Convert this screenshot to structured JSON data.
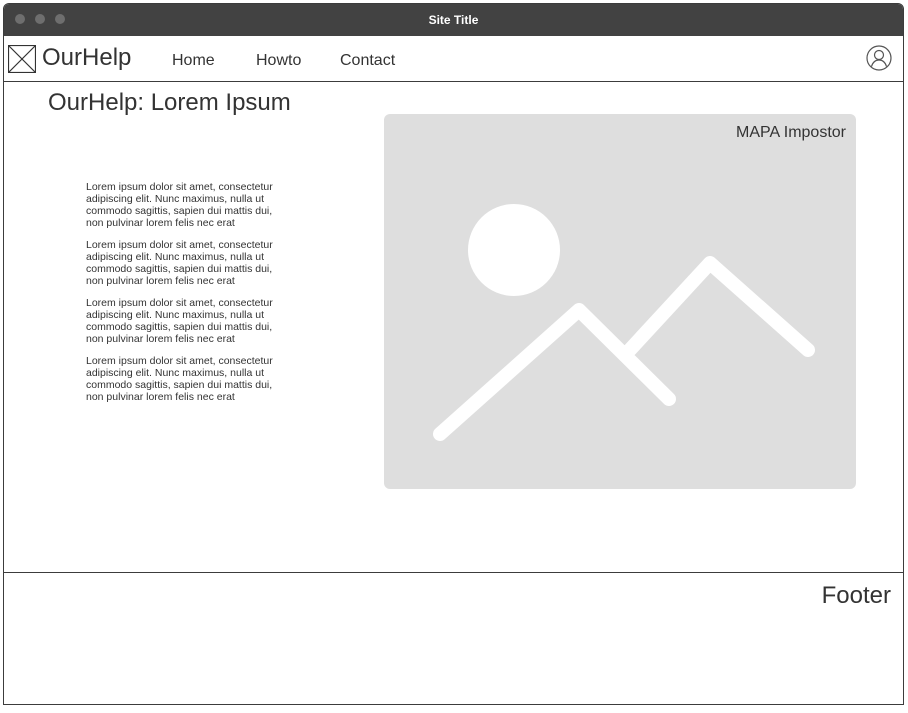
{
  "window": {
    "title": "Site Title"
  },
  "nav": {
    "brand": "OurHelp",
    "links": [
      "Home",
      "Howto",
      "Contact"
    ]
  },
  "main": {
    "headline": "OurHelp: Lorem Ipsum",
    "paragraphs": [
      "Lorem ipsum dolor sit amet, consectetur adipiscing elit. Nunc maximus, nulla ut commodo sagittis, sapien dui mattis dui, non pulvinar lorem felis nec erat",
      "Lorem ipsum dolor sit amet, consectetur adipiscing elit. Nunc maximus, nulla ut commodo sagittis, sapien dui mattis dui, non pulvinar lorem felis nec erat",
      "Lorem ipsum dolor sit amet, consectetur adipiscing elit. Nunc maximus, nulla ut commodo sagittis, sapien dui mattis dui, non pulvinar lorem felis nec erat",
      "Lorem ipsum dolor sit amet, consectetur adipiscing elit. Nunc maximus, nulla ut commodo sagittis, sapien dui mattis dui, non pulvinar lorem felis nec erat"
    ],
    "image_label": "MAPA Impostor"
  },
  "footer": {
    "label": "Footer"
  },
  "icons": {
    "logo": "image-placeholder-icon",
    "user": "user-icon",
    "image": "image-placeholder-icon"
  },
  "colors": {
    "titlebar": "#424242",
    "border": "#3c3c3c",
    "placeholder": "#dedede",
    "text": "#333333"
  }
}
